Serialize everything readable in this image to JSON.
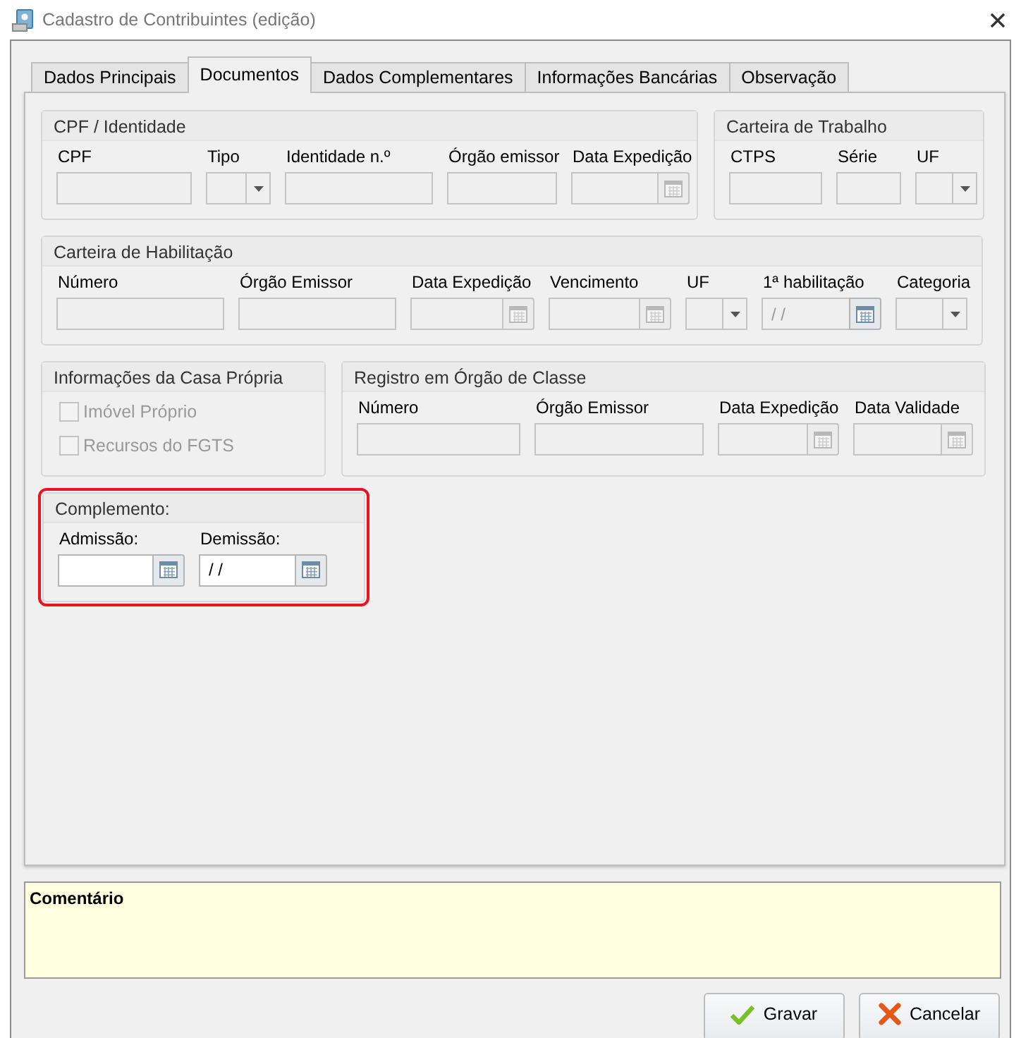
{
  "window": {
    "title": "Cadastro de Contribuintes (edição)"
  },
  "tabs": [
    {
      "label": "Dados Principais",
      "selected": false
    },
    {
      "label": "Documentos",
      "selected": true
    },
    {
      "label": "Dados Complementares",
      "selected": false
    },
    {
      "label": "Informações Bancárias",
      "selected": false
    },
    {
      "label": "Observação",
      "selected": false
    }
  ],
  "rows": [
    {
      "groups": [
        {
          "kind": "fields",
          "title": "CPF / Identidade",
          "highlighted": false,
          "fields": [
            {
              "kind": "text",
              "label": "CPF",
              "disabled": true
            },
            {
              "kind": "combo",
              "label": "Tipo",
              "disabled": true
            },
            {
              "kind": "text",
              "label": "Identidade n.º",
              "disabled": true
            },
            {
              "kind": "text",
              "label": "Órgão emissor",
              "disabled": true
            },
            {
              "kind": "date",
              "label": "Data Expedição",
              "disabled": true
            }
          ]
        },
        {
          "kind": "fields",
          "title": "Carteira de Trabalho",
          "highlighted": false,
          "fields": [
            {
              "kind": "text",
              "label": "CTPS",
              "disabled": true
            },
            {
              "kind": "text",
              "label": "Série",
              "disabled": true
            },
            {
              "kind": "combo",
              "label": "UF",
              "disabled": true
            }
          ]
        }
      ]
    },
    {
      "groups": [
        {
          "kind": "fields",
          "title": "Carteira de Habilitação",
          "highlighted": false,
          "fields": [
            {
              "kind": "text",
              "label": "Número",
              "disabled": true
            },
            {
              "kind": "text",
              "label": "Órgão Emissor",
              "disabled": true
            },
            {
              "kind": "date",
              "label": "Data Expedição",
              "disabled": true
            },
            {
              "kind": "date",
              "label": "Vencimento",
              "disabled": true
            },
            {
              "kind": "combo",
              "label": "UF",
              "disabled": true
            },
            {
              "kind": "date",
              "label": "1ª habilitação",
              "disabled": true,
              "value": "/ /"
            },
            {
              "kind": "combo",
              "label": "Categoria",
              "disabled": true
            }
          ]
        }
      ]
    },
    {
      "groups": [
        {
          "kind": "checks",
          "title": "Informações da Casa Própria",
          "highlighted": false,
          "items": [
            {
              "label": "Imóvel Próprio",
              "checked": false,
              "disabled": true
            },
            {
              "label": "Recursos do FGTS",
              "checked": false,
              "disabled": true
            }
          ]
        },
        {
          "kind": "fields",
          "title": "Registro em Órgão de Classe",
          "highlighted": false,
          "fields": [
            {
              "kind": "text",
              "label": "Número",
              "disabled": true
            },
            {
              "kind": "text",
              "label": "Órgão Emissor",
              "disabled": true
            },
            {
              "kind": "date",
              "label": "Data Expedição",
              "disabled": true
            },
            {
              "kind": "date",
              "label": "Data Validade",
              "disabled": true
            }
          ]
        }
      ]
    },
    {
      "groups": [
        {
          "kind": "fields",
          "title": "Complemento:",
          "highlighted": true,
          "fields": [
            {
              "kind": "date",
              "label": "Admissão:",
              "disabled": false
            },
            {
              "kind": "date",
              "label": "Demissão:",
              "disabled": false,
              "value": "/ /"
            }
          ]
        }
      ]
    }
  ],
  "comment": {
    "label": "Comentário"
  },
  "buttons": [
    {
      "kind": "confirm",
      "label": "Gravar"
    },
    {
      "kind": "cancel",
      "label": "Cancelar"
    }
  ]
}
